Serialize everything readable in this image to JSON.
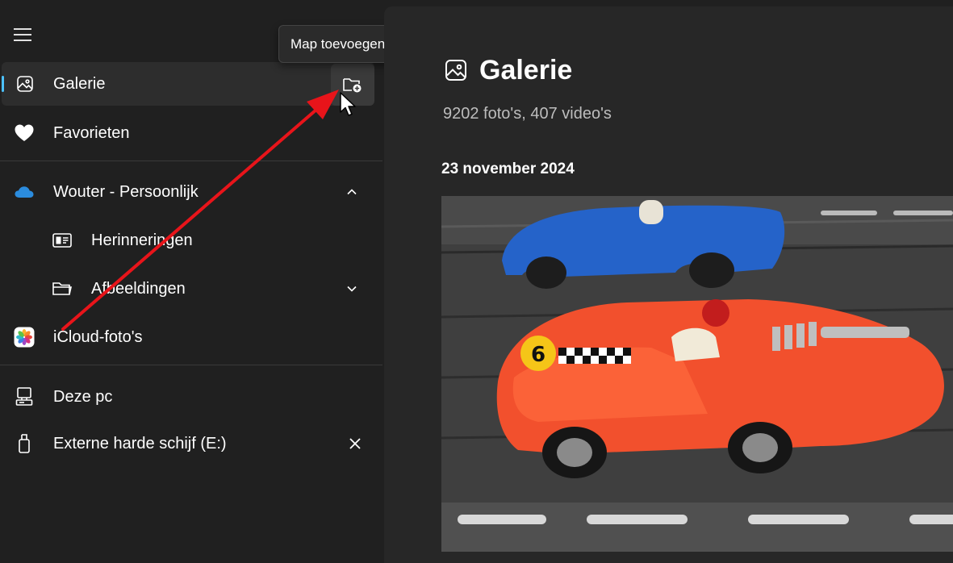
{
  "sidebar": {
    "items": [
      {
        "label": "Galerie",
        "icon": "gallery-icon",
        "selected": true
      },
      {
        "label": "Favorieten",
        "icon": "heart-icon"
      },
      {
        "label": "Wouter - Persoonlijk",
        "icon": "onedrive-cloud-icon",
        "expanded": true
      },
      {
        "label": "Herinneringen",
        "icon": "memories-icon"
      },
      {
        "label": "Afbeeldingen",
        "icon": "folder-icon"
      },
      {
        "label": "iCloud-foto's",
        "icon": "icloud-photos-icon"
      },
      {
        "label": "Deze pc",
        "icon": "computer-icon"
      },
      {
        "label": "Externe harde schijf (E:)",
        "icon": "usb-drive-icon"
      }
    ]
  },
  "tooltip": {
    "text": "Map toevoegen"
  },
  "main": {
    "title": "Galerie",
    "subtitle": "9202 foto's, 407 video's",
    "date_heading": "23 november 2024"
  },
  "colors": {
    "accent": "#4cc2ff",
    "annotation_arrow": "#e8141a",
    "background": "#202020",
    "panel": "#272727"
  }
}
